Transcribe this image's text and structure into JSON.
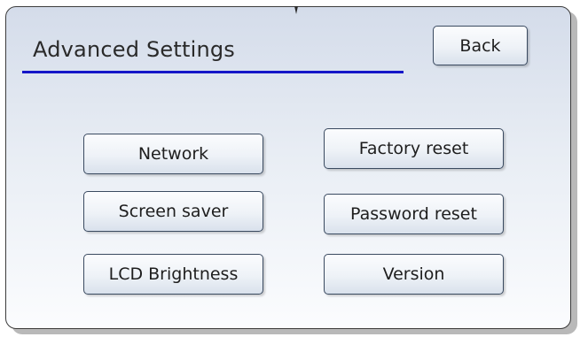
{
  "screen": {
    "title": "Advanced Settings",
    "back_label": "Back"
  },
  "menu": {
    "left": [
      {
        "label": "Network"
      },
      {
        "label": "Screen saver"
      },
      {
        "label": "LCD Brightness"
      }
    ],
    "right": [
      {
        "label": "Factory reset"
      },
      {
        "label": "Password reset"
      },
      {
        "label": "Version"
      }
    ]
  },
  "colors": {
    "accent_underline": "#1515c8",
    "panel_top": "#d4dcea",
    "panel_bottom": "#fbfcfe",
    "border": "#3c3c3c"
  },
  "icons": {
    "pointer": "down-arrow-indicator-icon"
  }
}
